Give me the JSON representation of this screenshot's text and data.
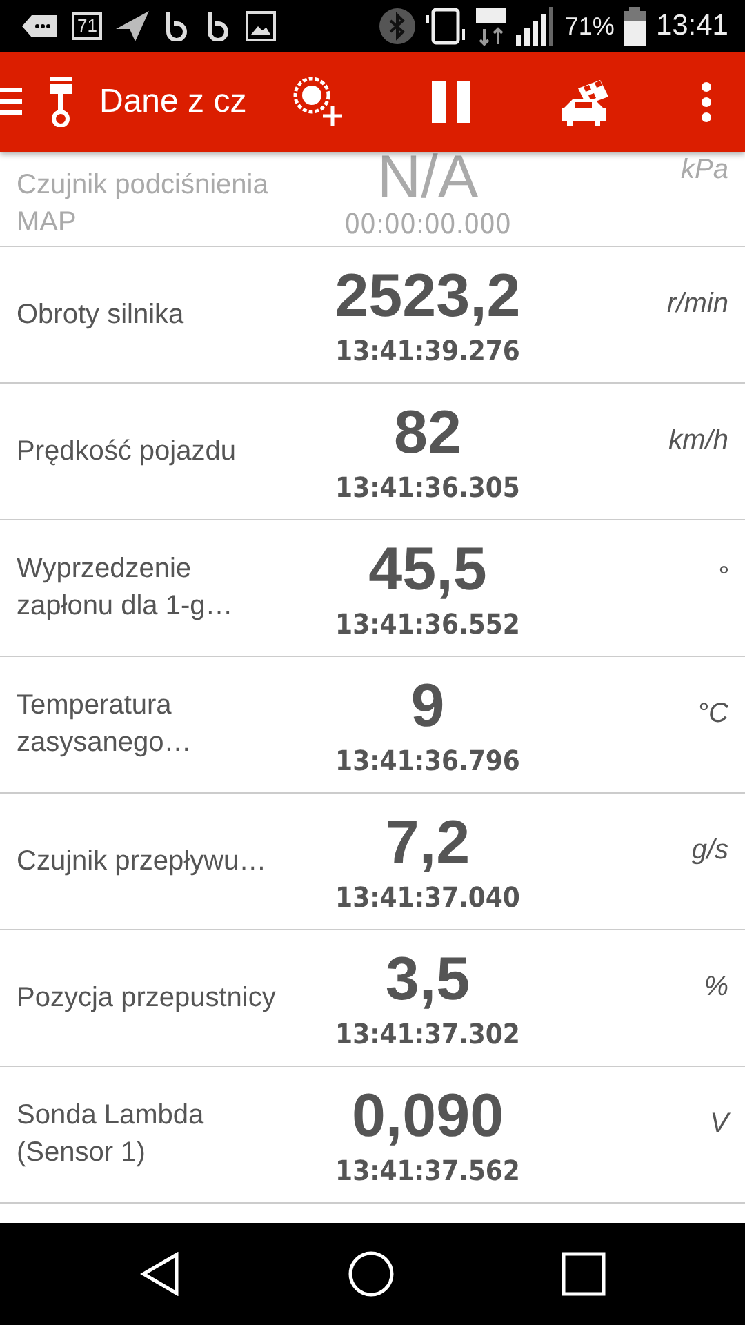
{
  "status_bar": {
    "battery": "71%",
    "time": "13:41",
    "battery_badge": "71"
  },
  "toolbar": {
    "title": "Dane z cz"
  },
  "rows": [
    {
      "label": "Czujnik podciśnienia MAP",
      "value": "N/A",
      "timestamp": "00:00:00.000",
      "unit": "kPa",
      "disabled": true
    },
    {
      "label": "Obroty silnika",
      "value": "2523,2",
      "timestamp": "13:41:39.276",
      "unit": "r/min",
      "disabled": false
    },
    {
      "label": "Prędkość pojazdu",
      "value": "82",
      "timestamp": "13:41:36.305",
      "unit": "km/h",
      "disabled": false
    },
    {
      "label": "Wyprzedzenie zapłonu dla 1-g…",
      "value": "45,5",
      "timestamp": "13:41:36.552",
      "unit": "°",
      "disabled": false
    },
    {
      "label": "Temperatura zasysanego…",
      "value": "9",
      "timestamp": "13:41:36.796",
      "unit": "°C",
      "disabled": false
    },
    {
      "label": "Czujnik przepływu…",
      "value": "7,2",
      "timestamp": "13:41:37.040",
      "unit": "g/s",
      "disabled": false
    },
    {
      "label": "Pozycja przepustnicy",
      "value": "3,5",
      "timestamp": "13:41:37.302",
      "unit": "%",
      "disabled": false
    },
    {
      "label": "Sonda Lambda (Sensor 1)",
      "value": "0,090",
      "timestamp": "13:41:37.562",
      "unit": "V",
      "disabled": false
    }
  ]
}
